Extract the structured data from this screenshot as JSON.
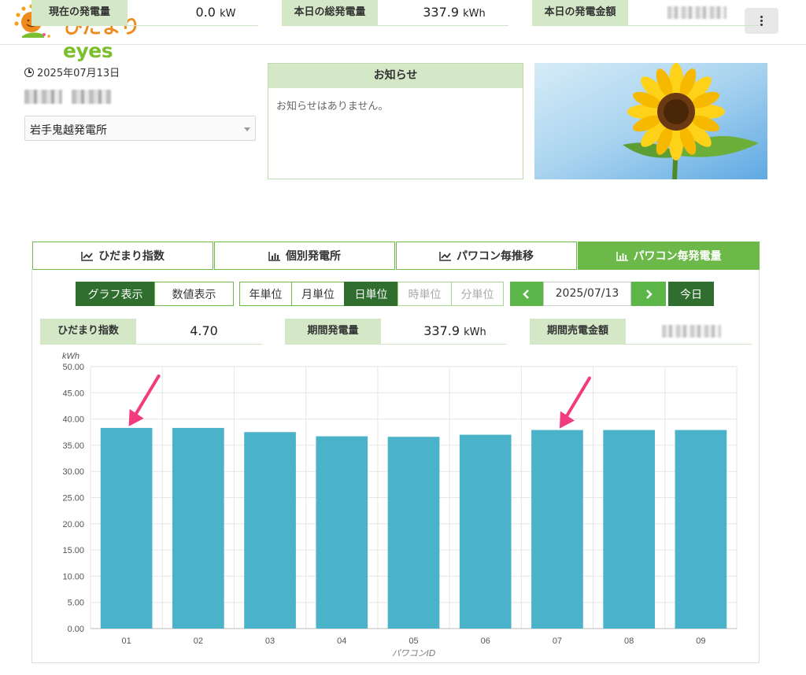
{
  "header": {
    "logo_text_hi": "ひだまり",
    "logo_text_eyes": "eyes"
  },
  "info": {
    "date": "2025年07月13日",
    "plant_select_value": "岩手鬼越発電所"
  },
  "notice": {
    "title": "お知らせ",
    "body": "お知らせはありません。"
  },
  "stats_top": {
    "current_label": "現在の発電量",
    "current_value": "0.0",
    "current_unit": "kW",
    "today_total_label": "本日の総発電量",
    "today_total_value": "337.9",
    "today_total_unit": "kWh",
    "today_amount_label": "本日の発電金額"
  },
  "tabs": [
    {
      "label": "ひだまり指数",
      "icon": "line-chart-icon"
    },
    {
      "label": "個別発電所",
      "icon": "bar-chart-icon"
    },
    {
      "label": "パワコン毎推移",
      "icon": "line-chart-icon"
    },
    {
      "label": "パワコン毎発電量",
      "icon": "bar-chart-icon"
    }
  ],
  "view_toggle": {
    "graph": "グラフ表示",
    "numeric": "数値表示"
  },
  "units": {
    "year": "年単位",
    "month": "月単位",
    "day": "日単位",
    "hour": "時単位",
    "minute": "分単位"
  },
  "date_nav": {
    "date": "2025/07/13",
    "today": "今日"
  },
  "stats_period": {
    "index_label": "ひだまり指数",
    "index_value": "4.70",
    "period_gen_label": "期間発電量",
    "period_gen_value": "337.9",
    "period_gen_unit": "kWh",
    "period_sales_label": "期間売電金額"
  },
  "colors": {
    "green_accent": "#6cb848",
    "dark_green": "#2f6e2f",
    "bar": "#4ab2c9",
    "arrow": "#f23a7e"
  },
  "chart_data": {
    "type": "bar",
    "categories": [
      "01",
      "02",
      "03",
      "04",
      "05",
      "06",
      "07",
      "08",
      "09"
    ],
    "values": [
      38.3,
      38.3,
      37.5,
      36.7,
      36.6,
      37.0,
      37.9,
      37.9,
      37.9
    ],
    "ylabel": "kWh",
    "xlabel": "パワコンID",
    "ylim": [
      0,
      50
    ],
    "yticks": [
      "0.00",
      "5.00",
      "10.00",
      "15.00",
      "20.00",
      "25.00",
      "30.00",
      "35.00",
      "40.00",
      "45.00",
      "50.00"
    ],
    "grid": true,
    "annotations": [
      {
        "type": "arrow",
        "target_category": "01"
      },
      {
        "type": "arrow",
        "target_category": "07"
      }
    ]
  }
}
